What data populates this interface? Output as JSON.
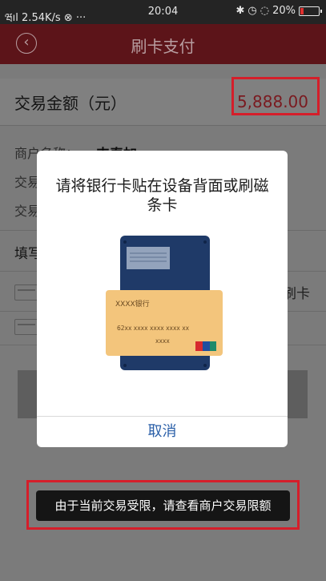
{
  "status_bar": {
    "left": "ཝıl 2.54K/s ⊗ ···",
    "time": "20:04",
    "right": "20%",
    "icons": [
      "signal-icon",
      "wifi-icon",
      "bluetooth-icon",
      "alarm-icon",
      "location-icon",
      "battery-icon"
    ],
    "battery_level": 0.2,
    "battery_color": "#e0302f"
  },
  "nav": {
    "back_icon": "chevron-left-icon",
    "title": "刷卡支付",
    "background": "#5c1419"
  },
  "transaction": {
    "amount_label": "交易金额（元）",
    "amount_value": "5,888.00"
  },
  "info": {
    "merchant_label": "商户名称：",
    "merchant_value": "丰泰加",
    "row2_label": "交易",
    "row3_label": "交易"
  },
  "section": {
    "title": "填写",
    "swipe_label": "刷卡"
  },
  "modal": {
    "title": "请将银行卡贴在设备背面或刷磁条卡",
    "card_bank": "XXXX银行",
    "card_number": "62xx  xxxx  xxxx  xxxx  xx",
    "card_number_tail": "xxxx",
    "card_logo": "unionpay-logo-icon",
    "cancel_label": "取消"
  },
  "toast": {
    "message": "由于当前交易受限，请查看商户交易限额"
  },
  "highlight_color": "#d51e2a"
}
